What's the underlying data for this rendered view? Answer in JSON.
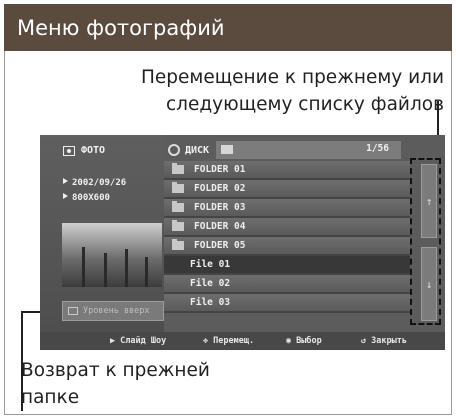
{
  "header": {
    "title": "Меню фотографий"
  },
  "callouts": {
    "nav_line1": "Перемещение к прежнему или",
    "nav_line2": "следующему списку файлов",
    "back_line1": "Возврат к прежней",
    "back_line2": "папке"
  },
  "screen": {
    "left": {
      "mode_label": "ФОТО",
      "date": "2002/09/26",
      "resolution": "800X600",
      "up_button": "Уровень вверх"
    },
    "top": {
      "disc_label": "ДИСК",
      "page_count": "1/56"
    },
    "files": [
      {
        "name": "FOLDER  01",
        "type": "folder"
      },
      {
        "name": "FOLDER  02",
        "type": "folder"
      },
      {
        "name": "FOLDER  03",
        "type": "folder"
      },
      {
        "name": "FOLDER  04",
        "type": "folder"
      },
      {
        "name": "FOLDER  05",
        "type": "folder"
      },
      {
        "name": "File  01",
        "type": "file",
        "selected": true
      },
      {
        "name": "File  02",
        "type": "file"
      },
      {
        "name": "File  03",
        "type": "file"
      }
    ],
    "statusbar": {
      "slideshow": "Слайд Шоу",
      "move": "Перемещ.",
      "select": "Выбор",
      "close": "Закрыть"
    }
  },
  "icons": [
    "camera-icon",
    "disc-icon",
    "folder-icon",
    "up-arrow-icon",
    "down-arrow-icon",
    "play-icon",
    "move-icon",
    "select-icon",
    "close-icon"
  ]
}
